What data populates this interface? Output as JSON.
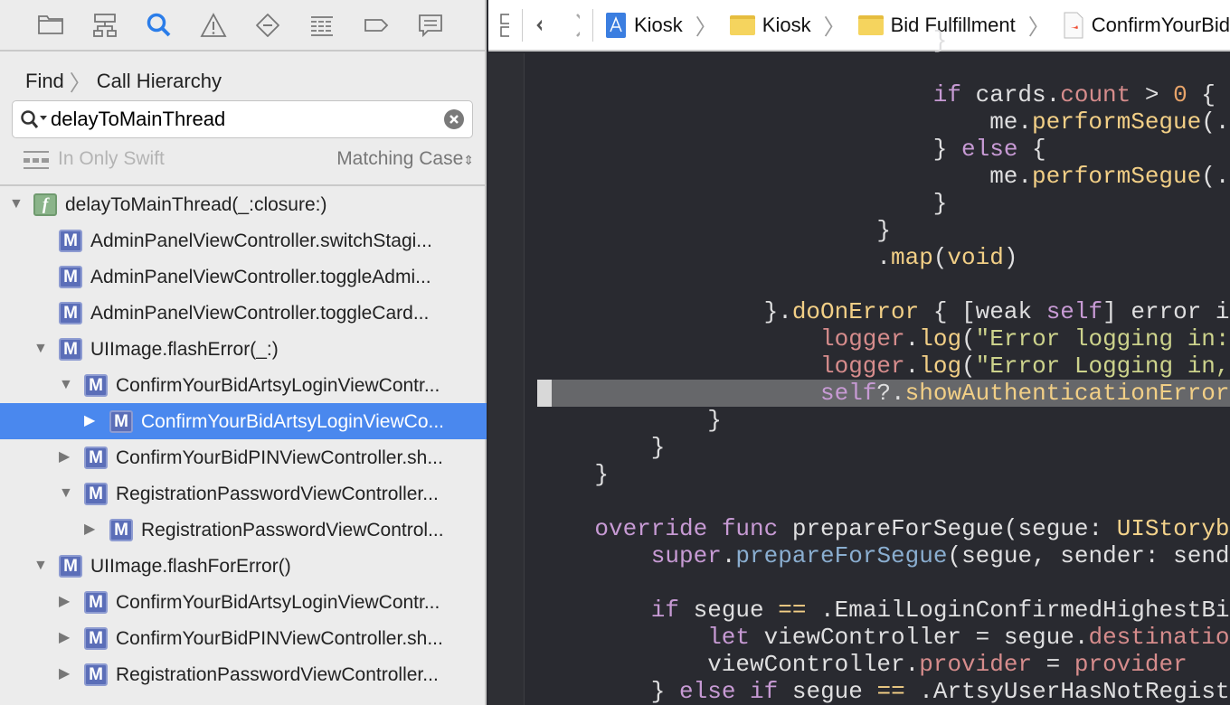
{
  "navigator": {
    "icons": [
      "folder-icon",
      "hierarchy-icon",
      "search-icon",
      "warning-icon",
      "breakpoint-icon",
      "list-icon",
      "tag-icon",
      "comment-icon"
    ],
    "active": "search-icon",
    "accent": "#2b7de9"
  },
  "breadcrumb": {
    "items": [
      "Find",
      "Call Hierarchy"
    ]
  },
  "search": {
    "value": "delayToMainThread"
  },
  "options": {
    "scope": "In Only Swift",
    "matching": "Matching Case"
  },
  "tree": [
    {
      "level": 0,
      "disclosure": "open",
      "icon": "f",
      "label": "delayToMainThread(_:closure:)"
    },
    {
      "level": 1,
      "disclosure": "none",
      "icon": "M",
      "label": "AdminPanelViewController.switchStagi..."
    },
    {
      "level": 1,
      "disclosure": "none",
      "icon": "M",
      "label": "AdminPanelViewController.toggleAdmi..."
    },
    {
      "level": 1,
      "disclosure": "none",
      "icon": "M",
      "label": "AdminPanelViewController.toggleCard..."
    },
    {
      "level": 1,
      "disclosure": "open",
      "icon": "M",
      "label": "UIImage.flashError(_:)"
    },
    {
      "level": 2,
      "disclosure": "open",
      "icon": "M",
      "label": "ConfirmYourBidArtsyLoginViewContr..."
    },
    {
      "level": 3,
      "disclosure": "closed",
      "icon": "M",
      "label": "ConfirmYourBidArtsyLoginViewCo...",
      "selected": true
    },
    {
      "level": 2,
      "disclosure": "closed",
      "icon": "M",
      "label": "ConfirmYourBidPINViewController.sh..."
    },
    {
      "level": 2,
      "disclosure": "open",
      "icon": "M",
      "label": "RegistrationPasswordViewController..."
    },
    {
      "level": 3,
      "disclosure": "closed",
      "icon": "M",
      "label": "RegistrationPasswordViewControl..."
    },
    {
      "level": 1,
      "disclosure": "open",
      "icon": "M",
      "label": "UIImage.flashForError()"
    },
    {
      "level": 2,
      "disclosure": "closed",
      "icon": "M",
      "label": "ConfirmYourBidArtsyLoginViewContr..."
    },
    {
      "level": 2,
      "disclosure": "closed",
      "icon": "M",
      "label": "ConfirmYourBidPINViewController.sh..."
    },
    {
      "level": 2,
      "disclosure": "closed",
      "icon": "M",
      "label": "RegistrationPasswordViewController..."
    }
  ],
  "jumpbar": {
    "items": [
      {
        "icon": "project-icon",
        "label": "Kiosk"
      },
      {
        "icon": "folder-icon",
        "label": "Kiosk"
      },
      {
        "icon": "folder-icon",
        "label": "Bid Fulfillment"
      },
      {
        "icon": "swift-file-icon",
        "label": "ConfirmYourBid"
      }
    ]
  },
  "editor": {
    "highlighted_line": 12,
    "lines": [
      {
        "indent": 28,
        "tokens": [
          [
            "}",
            "plain"
          ]
        ]
      },
      {
        "indent": 0,
        "tokens": []
      },
      {
        "indent": 28,
        "tokens": [
          [
            "if",
            "kw"
          ],
          [
            " cards.",
            "plain"
          ],
          [
            "count",
            "prop"
          ],
          [
            " > ",
            "plain"
          ],
          [
            "0",
            "num"
          ],
          [
            " {",
            "plain"
          ]
        ]
      },
      {
        "indent": 32,
        "tokens": [
          [
            "me.",
            "plain"
          ],
          [
            "performSegue",
            "fn"
          ],
          [
            "(.",
            "plain"
          ]
        ]
      },
      {
        "indent": 28,
        "tokens": [
          [
            "} ",
            "plain"
          ],
          [
            "else",
            "kw"
          ],
          [
            " {",
            "plain"
          ]
        ]
      },
      {
        "indent": 32,
        "tokens": [
          [
            "me.",
            "plain"
          ],
          [
            "performSegue",
            "fn"
          ],
          [
            "(.",
            "plain"
          ]
        ]
      },
      {
        "indent": 28,
        "tokens": [
          [
            "}",
            "plain"
          ]
        ]
      },
      {
        "indent": 24,
        "tokens": [
          [
            "}",
            "plain"
          ]
        ]
      },
      {
        "indent": 24,
        "tokens": [
          [
            ".",
            "plain"
          ],
          [
            "map",
            "fn"
          ],
          [
            "(",
            "plain"
          ],
          [
            "void",
            "fn"
          ],
          [
            ")",
            "plain"
          ]
        ]
      },
      {
        "indent": 0,
        "tokens": []
      },
      {
        "indent": 16,
        "tokens": [
          [
            "}.",
            "plain"
          ],
          [
            "doOnError",
            "fn"
          ],
          [
            " { [weak ",
            "plain"
          ],
          [
            "self",
            "kw"
          ],
          [
            "] error in",
            "plain"
          ]
        ]
      },
      {
        "indent": 20,
        "tokens": [
          [
            "logger",
            "prop"
          ],
          [
            ".",
            "plain"
          ],
          [
            "log",
            "fn"
          ],
          [
            "(",
            "plain"
          ],
          [
            "\"Error logging in:",
            "str"
          ]
        ]
      },
      {
        "indent": 20,
        "tokens": [
          [
            "logger",
            "prop"
          ],
          [
            ".",
            "plain"
          ],
          [
            "log",
            "fn"
          ],
          [
            "(",
            "plain"
          ],
          [
            "\"Error Logging in,",
            "str"
          ]
        ]
      },
      {
        "indent": 20,
        "tokens": [
          [
            "self",
            "kw"
          ],
          [
            "?.",
            "plain"
          ],
          [
            "showAuthenticationError",
            "fn"
          ]
        ]
      },
      {
        "indent": 12,
        "tokens": [
          [
            "}",
            "plain"
          ]
        ]
      },
      {
        "indent": 8,
        "tokens": [
          [
            "}",
            "plain"
          ]
        ]
      },
      {
        "indent": 4,
        "tokens": [
          [
            "}",
            "plain"
          ]
        ]
      },
      {
        "indent": 0,
        "tokens": []
      },
      {
        "indent": 4,
        "tokens": [
          [
            "override",
            "kw"
          ],
          [
            " ",
            "plain"
          ],
          [
            "func",
            "kw"
          ],
          [
            " prepareForSegue(segue: ",
            "plain"
          ],
          [
            "UIStoryb",
            "type"
          ]
        ]
      },
      {
        "indent": 8,
        "tokens": [
          [
            "super",
            "kw"
          ],
          [
            ".",
            "plain"
          ],
          [
            "prepareForSegue",
            "method"
          ],
          [
            "(segue, sender: send",
            "plain"
          ]
        ]
      },
      {
        "indent": 0,
        "tokens": []
      },
      {
        "indent": 8,
        "tokens": [
          [
            "if",
            "kw"
          ],
          [
            " segue ",
            "plain"
          ],
          [
            "==",
            "fn"
          ],
          [
            " .EmailLoginConfirmedHighestBi",
            "plain"
          ]
        ]
      },
      {
        "indent": 12,
        "tokens": [
          [
            "let",
            "kw"
          ],
          [
            " viewController = segue.",
            "plain"
          ],
          [
            "destinatio",
            "prop"
          ]
        ]
      },
      {
        "indent": 12,
        "tokens": [
          [
            "viewController.",
            "plain"
          ],
          [
            "provider",
            "prop"
          ],
          [
            " = ",
            "plain"
          ],
          [
            "provider",
            "prop"
          ]
        ]
      },
      {
        "indent": 8,
        "tokens": [
          [
            "} ",
            "plain"
          ],
          [
            "else",
            "kw"
          ],
          [
            " ",
            "plain"
          ],
          [
            "if",
            "kw"
          ],
          [
            " segue ",
            "plain"
          ],
          [
            "==",
            "fn"
          ],
          [
            " .ArtsyUserHasNotRegist",
            "plain"
          ]
        ]
      }
    ]
  }
}
